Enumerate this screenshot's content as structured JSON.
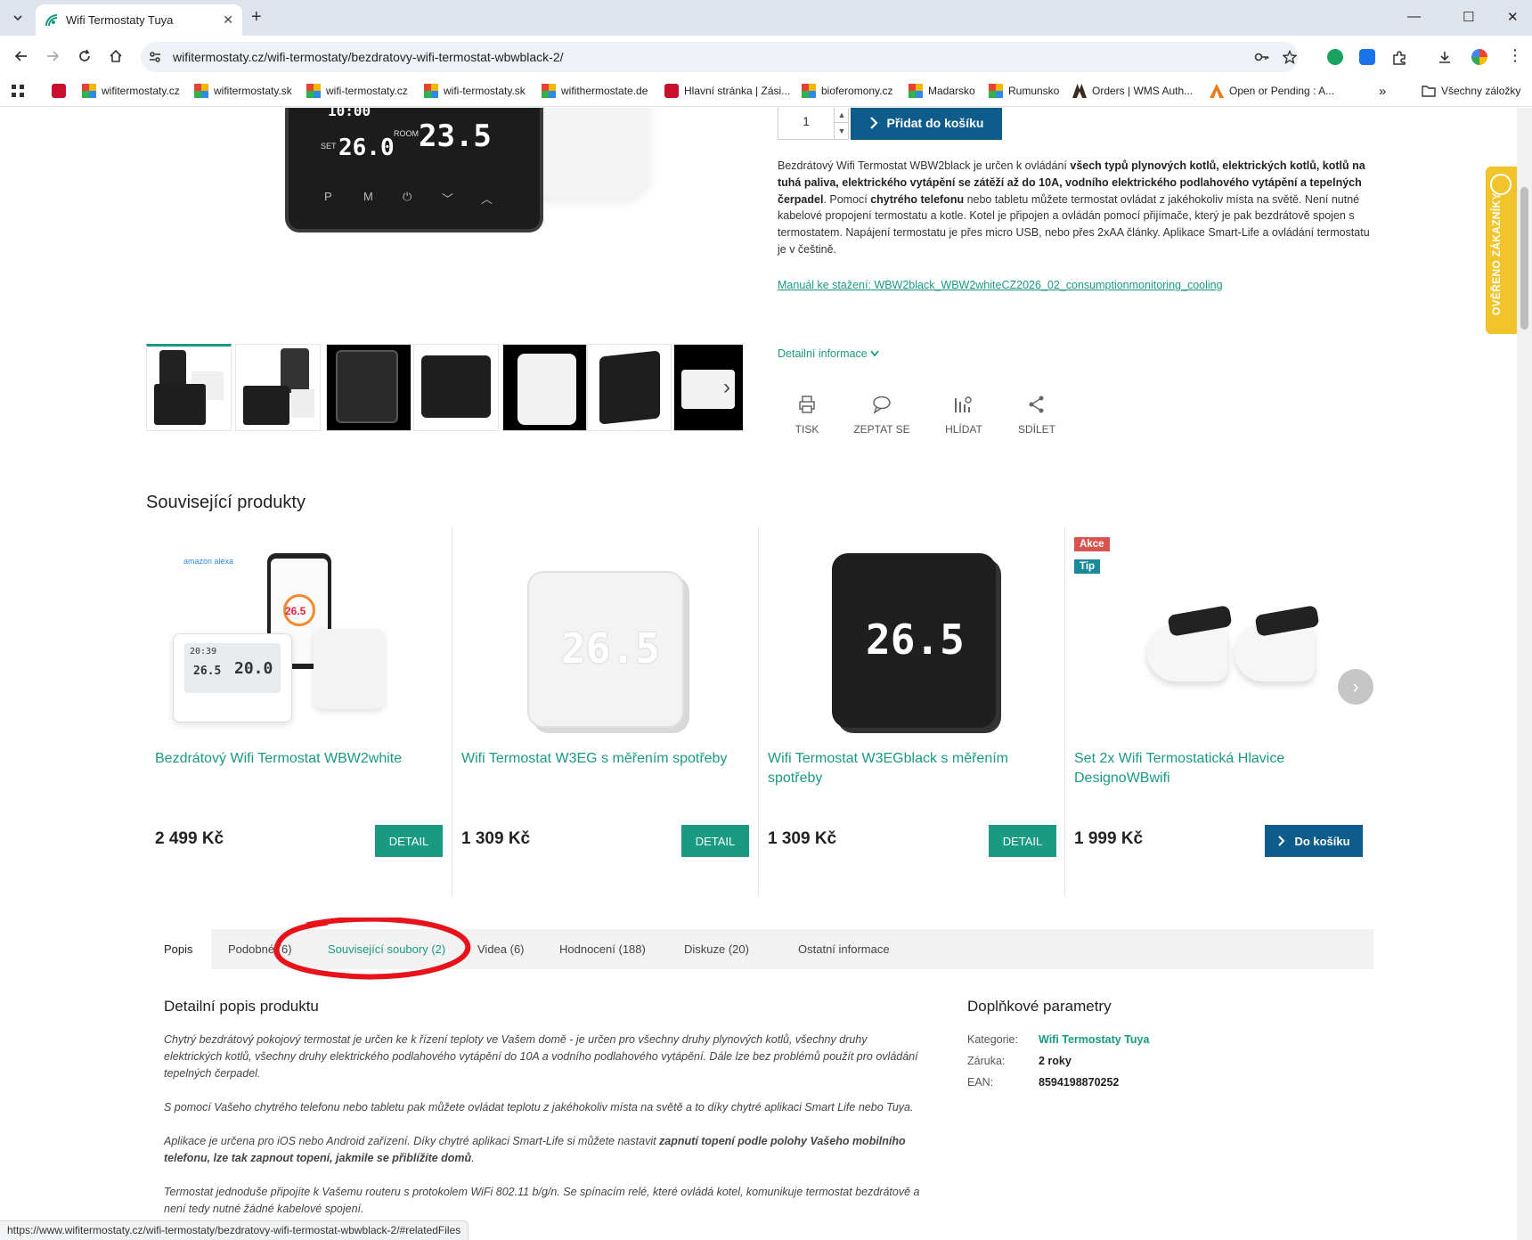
{
  "browser": {
    "tab_title": "Wifi Termostaty Tuya",
    "url": "wifitermostaty.cz/wifi-termostaty/bezdratovy-wifi-termostat-wbwblack-2/",
    "bookmarks": [
      {
        "label": "wifitermostaty.cz",
        "icon": "tuya-icon"
      },
      {
        "label": "wifitermostaty.sk",
        "icon": "tuya-icon"
      },
      {
        "label": "wifi-termostaty.cz",
        "icon": "tuya-icon"
      },
      {
        "label": "wifi-termostaty.sk",
        "icon": "tuya-icon"
      },
      {
        "label": "wifithermostate.de",
        "icon": "tuya-icon"
      },
      {
        "label": "Hlavní stránka | Zási...",
        "icon": "shop-icon"
      },
      {
        "label": "bioferomony.cz",
        "icon": "tuya-icon"
      },
      {
        "label": "Madarsko",
        "icon": "tuya-icon"
      },
      {
        "label": "Rumunsko",
        "icon": "tuya-icon"
      },
      {
        "label": "Orders | WMS Auth...",
        "icon": "wms-icon"
      },
      {
        "label": "Open or Pending : A...",
        "icon": "ali-icon"
      }
    ],
    "all_bookmarks": "Všechny záložky",
    "status_url": "https://www.wifitermostaty.cz/wifi-termostaty/bezdratovy-wifi-termostat-wbwblack-2/#relatedFiles"
  },
  "product": {
    "qty": "1",
    "add_to_cart": "Přidat do košíku",
    "device": {
      "set_label": "SET",
      "set_value": "26.0",
      "room_label": "ROOM",
      "room_value": "23.5",
      "time": "10:00",
      "buttons": [
        "P",
        "M",
        "⏻",
        "﹀",
        "︿"
      ]
    },
    "description_parts": [
      {
        "t": "Bezdrátový Wifi Termostat WBW2black je určen k ovládání ",
        "b": false
      },
      {
        "t": "všech typů plynových kotlů, elektrických kotlů, kotlů na tuhá paliva, elektrického vytápění se zátěží až do 10A, vodního elektrického podlahového vytápění a tepelných čerpadel",
        "b": true
      },
      {
        "t": ". Pomocí ",
        "b": false
      },
      {
        "t": "chytrého telefonu",
        "b": true
      },
      {
        "t": " nebo tabletu můžete termostat ovládat z jakéhokoliv místa na světě. Není nutné kabelové propojení termostatu a kotle. Kotel je připojen a ovládán pomocí přijímače, který je pak bezdrátově spojen s termostatem. Napájení termostatu je přes micro USB, nebo přes 2xAA články. Aplikace Smart-Life a ovládání termostatu je v češtině.",
        "b": false
      }
    ],
    "manual_link": "Manuál ke stažení: WBW2black_WBW2whiteCZ2026_02_consumptionmonitoring_cooling",
    "detail_info": "Detailní informace",
    "actions": [
      {
        "label": "TISK",
        "icon": "print-icon"
      },
      {
        "label": "ZEPTAT SE",
        "icon": "chat-icon"
      },
      {
        "label": "HLÍDAT",
        "icon": "watchdog-icon"
      },
      {
        "label": "SDÍLET",
        "icon": "share-icon"
      }
    ]
  },
  "related": {
    "title": "Související produkty",
    "items": [
      {
        "name": "Bezdrátový Wifi Termostat WBW2white",
        "price": "2 499 Kč",
        "button": "DETAIL"
      },
      {
        "name": "Wifi Termostat W3EG s měřením spotřeby",
        "price": "1 309 Kč",
        "button": "DETAIL"
      },
      {
        "name": "Wifi Termostat W3EGblack s měřením spotřeby",
        "price": "1 309 Kč",
        "button": "DETAIL"
      },
      {
        "name": "Set 2x Wifi Termostatická Hlavice DesignoWBwifi",
        "price": "1 999 Kč",
        "button": "Do košíku",
        "badges": [
          "Akce",
          "Tip"
        ]
      }
    ],
    "item1_screen": {
      "app_temp": "26.5",
      "time": "20:39",
      "set": "26.5",
      "room": "20.0",
      "alexa": "amazon alexa"
    },
    "item23_display": "26.5"
  },
  "tabs": [
    {
      "label": "Popis",
      "active": true
    },
    {
      "label": "Podobné (6)",
      "active": false
    },
    {
      "label": "Související soubory (2)",
      "active": false,
      "highlight": true
    },
    {
      "label": "Videa (6)",
      "active": false
    },
    {
      "label": "Hodnocení (188)",
      "active": false
    },
    {
      "label": "Diskuze (20)",
      "active": false
    },
    {
      "label": "Ostatní informace",
      "active": false
    }
  ],
  "details": {
    "title": "Detailní popis produktu",
    "p1": "Chytrý bezdrátový pokojový termostat je určen ke k řízení teploty ve Vašem domě - je určen pro všechny druhy plynových kotlů, všechny druhy elektrických kotlů, všechny druhy elektrického podlahového vytápění do 10A a vodního podlahového vytápění. Dále lze bez problémů použít pro ovládání tepelných čerpadel.",
    "p2": "S pomocí Vašeho chytrého telefonu nebo tabletu pak můžete ovládat teplotu z jakéhokoliv místa na světě a to díky chytré aplikaci Smart Life nebo Tuya.",
    "p3_a": " Aplikace je určena pro iOS nebo Android zařízení. Díky chytré aplikaci Smart-Life si můžete nastavit ",
    "p3_b": "zapnutí topení podle polohy Vašeho mobilního telefonu, lze tak zapnout topení, jakmile se přiblížíte domů",
    "p3_c": ".",
    "p4": "Termostat jednoduše připojíte k Vašemu routeru s protokolem WiFi 802.11 b/g/n. Se spínacím relé, které ovládá kotel, komunikuje termostat bezdrátově a není tedy nutné žádné kabelové spojení."
  },
  "params": {
    "title": "Doplňkové parametry",
    "rows": [
      {
        "label": "Kategorie:",
        "value": "Wifi Termostaty Tuya",
        "link": true
      },
      {
        "label": "Záruka:",
        "value": "2 roky",
        "link": false
      },
      {
        "label": "EAN:",
        "value": "8594198870252",
        "link": false
      }
    ]
  },
  "verified_badge": "OVĚŘENO ZÁKAZNÍKY",
  "colors": {
    "accent": "#1a9a82",
    "cta": "#0e5c8c",
    "badge_sale": "#d9534f",
    "badge_tip": "#1a8a9a",
    "verified": "#f2c42b",
    "annotation": "#e8121b"
  }
}
